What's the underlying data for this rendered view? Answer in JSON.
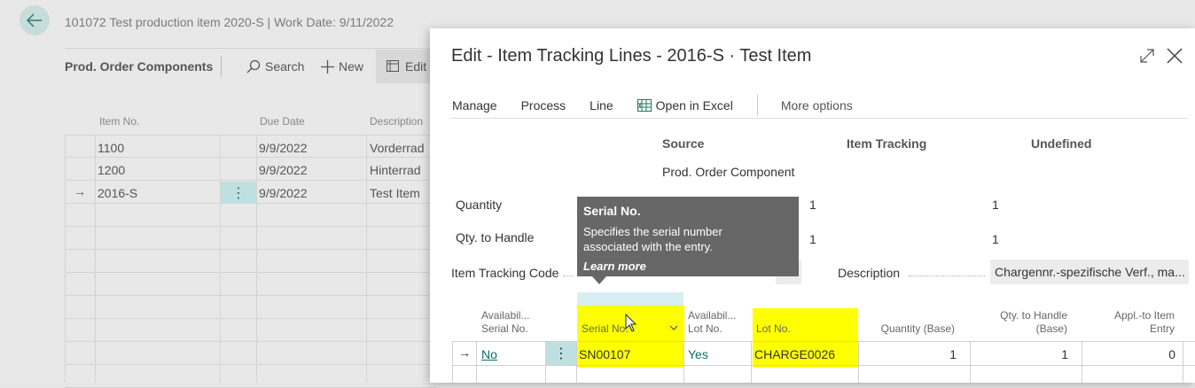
{
  "background": {
    "title": "101072 Test production item 2020-S | Work Date: 9/11/2022",
    "subtitle": "Prod. Order Components",
    "actions": {
      "search": "Search",
      "new": "New",
      "edit": "Edit"
    },
    "columns": {
      "item_no": "Item No.",
      "due_date": "Due Date",
      "description": "Description"
    },
    "rows": [
      {
        "item_no": "1100",
        "due_date": "9/9/2022",
        "description": "Vorderrad"
      },
      {
        "item_no": "1200",
        "due_date": "9/9/2022",
        "description": "Hinterrad"
      },
      {
        "item_no": "2016-S",
        "due_date": "9/9/2022",
        "description": "Test  Item"
      }
    ]
  },
  "dialog": {
    "title": "Edit - Item Tracking Lines - 2016-S · Test  Item",
    "menu": {
      "manage": "Manage",
      "process": "Process",
      "line": "Line",
      "open_in_excel": "Open in Excel",
      "more_options": "More options"
    },
    "summary": {
      "headers": {
        "source": "Source",
        "item_tracking": "Item Tracking",
        "undefined": "Undefined"
      },
      "source_name": "Prod. Order Component",
      "quantity_label": "Quantity",
      "qty_to_handle_label": "Qty. to Handle",
      "quantity": {
        "item_tracking": "1",
        "undefined": "1"
      },
      "qty_to_handle": {
        "item_tracking": "1",
        "undefined": "1"
      },
      "item_tracking_code_label": "Item Tracking Code",
      "description_label": "Description",
      "description_value": "Chargennr.-spezifische Verf., ma..."
    },
    "tooltip": {
      "title": "Serial No.",
      "body_line1": "Specifies the serial number",
      "body_line2": "associated with the entry.",
      "link": "Learn more"
    },
    "lines": {
      "headers": {
        "avail_serial_1": "Availabil...",
        "avail_serial_2": "Serial No.",
        "serial_no": "Serial No.",
        "avail_lot_1": "Availabil...",
        "avail_lot_2": "Lot No.",
        "lot_no": "Lot No.",
        "qty_base": "Quantity (Base)",
        "qty_handle_1": "Qty. to Handle",
        "qty_handle_2": "(Base)",
        "appl_1": "Appl.-to Item",
        "appl_2": "Entry"
      },
      "rows": [
        {
          "avail_serial": "No",
          "serial_no": "SN00107",
          "avail_lot": "Yes",
          "lot_no": "CHARGE0026",
          "qty_base": "1",
          "qty_handle": "1",
          "appl_entry": "0"
        }
      ]
    },
    "highlight_color": "#ffff00"
  }
}
